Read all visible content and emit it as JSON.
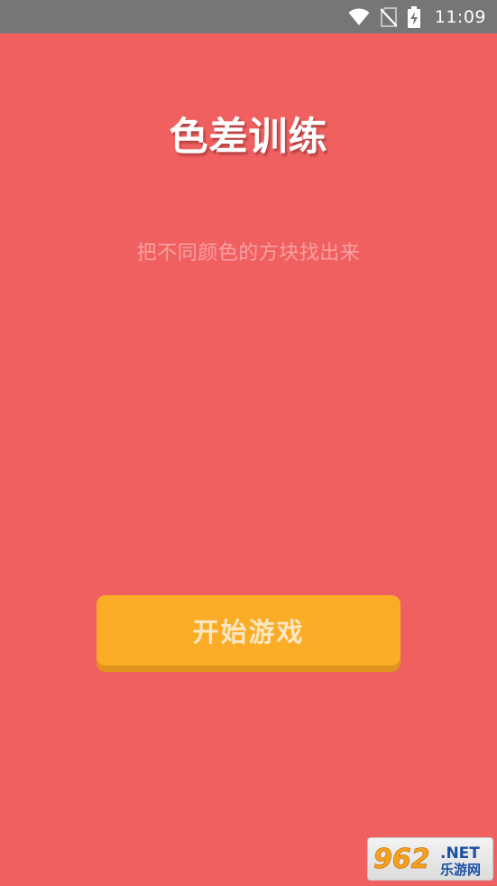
{
  "status_bar": {
    "time": "11:09",
    "icons": [
      "wifi-icon",
      "no-sim-icon",
      "battery-charging-icon"
    ]
  },
  "game": {
    "title": "色差训练",
    "subtitle": "把不同颜色的方块找出来",
    "start_button_label": "开始游戏"
  },
  "watermark": {
    "brand_number": "962",
    "brand_suffix": ".NET",
    "brand_name": "乐游网"
  },
  "colors": {
    "background": "#F06060",
    "status_bar": "#767676",
    "button": "#FAAC27",
    "button_shadow": "#DF931D",
    "button_text": "#FBE7C2",
    "subtitle_text": "#F7A0A0"
  }
}
